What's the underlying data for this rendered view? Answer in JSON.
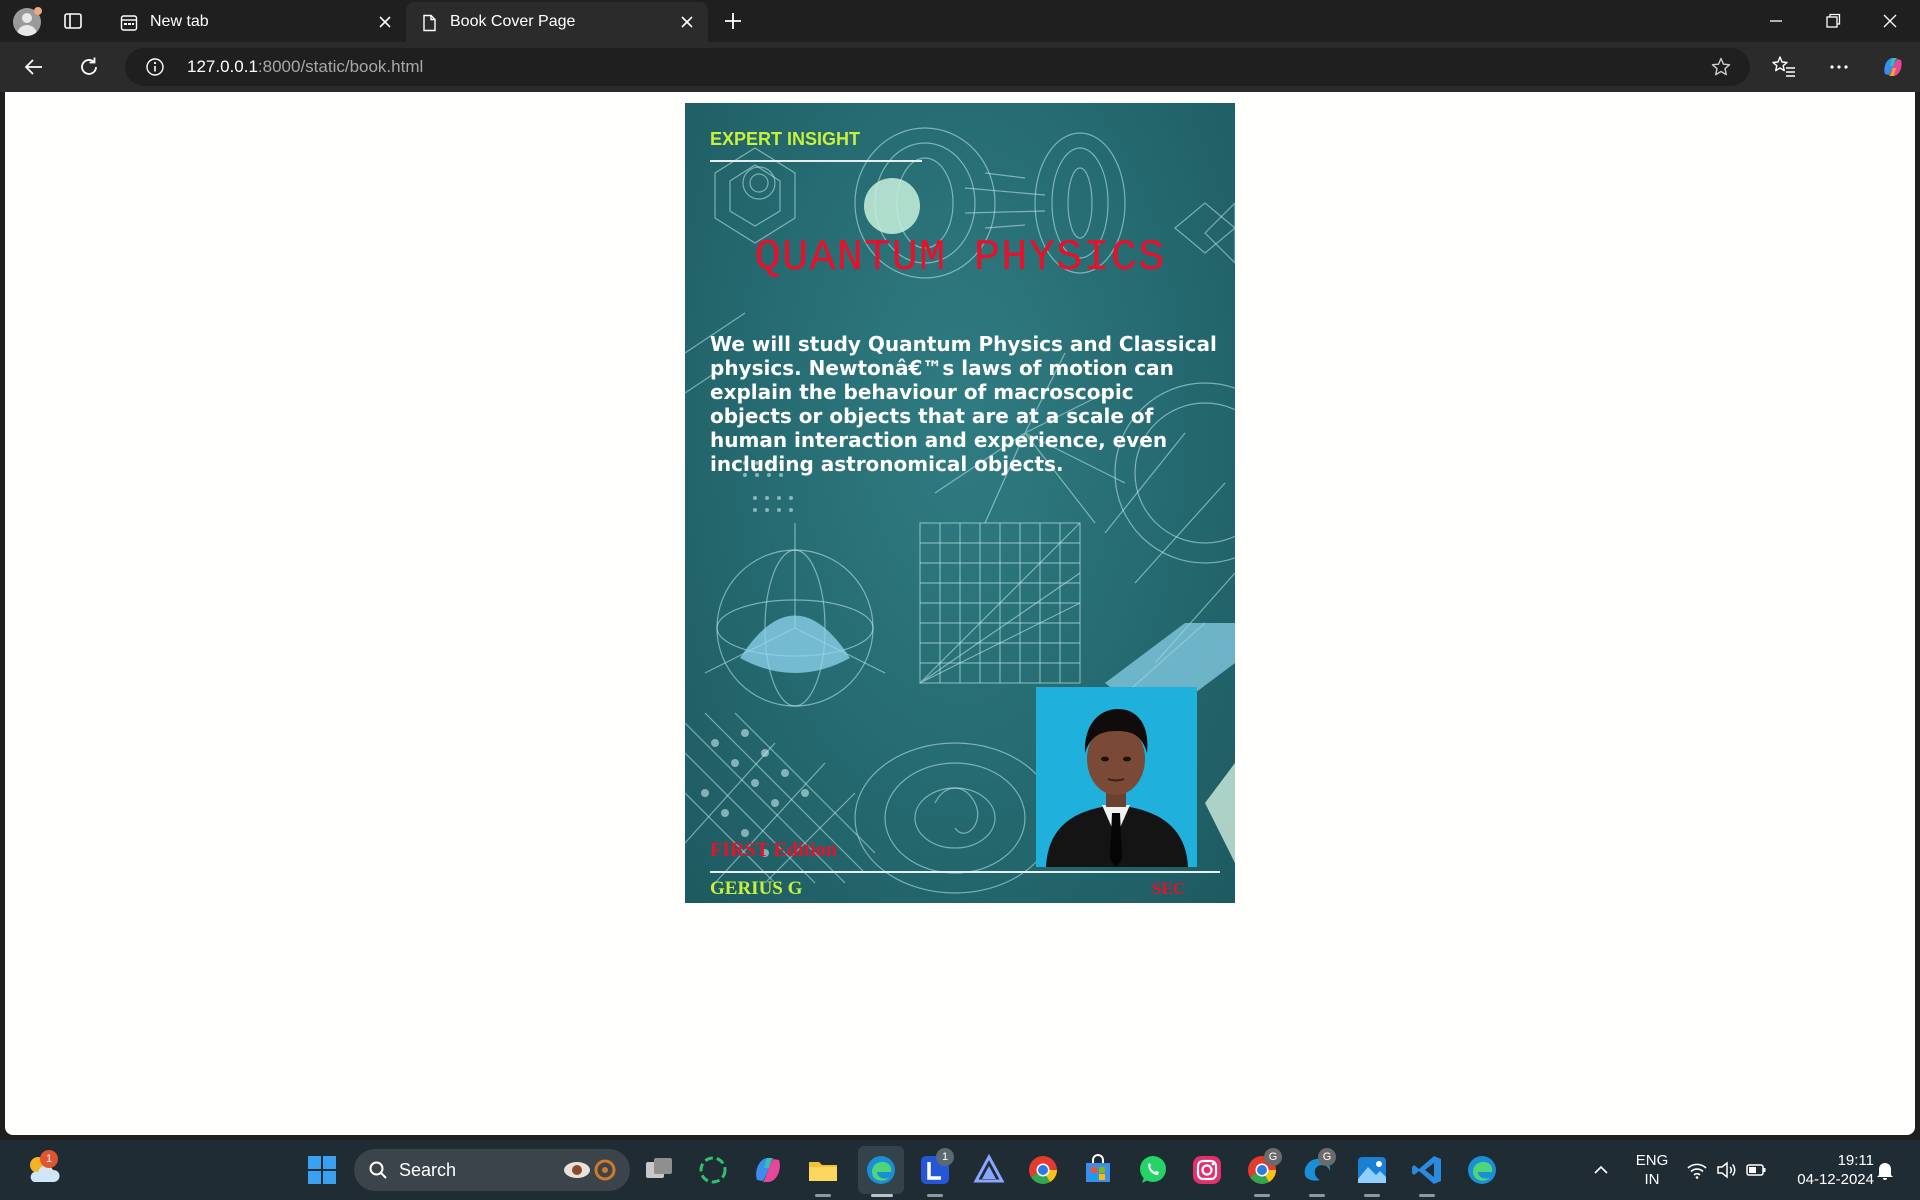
{
  "browser": {
    "tabs": [
      {
        "label": "New tab",
        "active": false
      },
      {
        "label": "Book Cover Page",
        "active": true
      }
    ],
    "address": {
      "host": "127.0.0.1",
      "rest": ":8000/static/book.html"
    }
  },
  "cover": {
    "series_label": "EXPERT INSIGHT",
    "title": "QUANTUM PHYSICS",
    "description": "We will study Quantum Physics and Classical physics. Newtonâ€™s laws of motion can explain the behaviour of macroscopic objects or objects that are at a scale of human interaction and experience, even including astronomical objects.",
    "edition": "FIRST Edition",
    "author": "GERIUS G",
    "publisher": "SEC",
    "colors": {
      "accent_green": "#c7f13a",
      "accent_red": "#e8102a",
      "background": "#256a70"
    }
  },
  "taskbar": {
    "search_label": "Search",
    "weather_badge": "1",
    "lens_badge": "1",
    "chrome_badge": "G",
    "edge_badge": "G",
    "language_top": "ENG",
    "language_bottom": "IN",
    "time": "19:11",
    "date": "04-12-2024",
    "icons": [
      "weather-icon",
      "windows-start-icon",
      "search-icon",
      "task-view-icon",
      "copilot-icon",
      "file-explorer-icon",
      "edge-icon",
      "lens-icon",
      "affine-icon",
      "chrome-icon",
      "store-icon",
      "whatsapp-icon",
      "instagram-icon",
      "chrome-profile-icon",
      "edge-profile-icon",
      "photos-icon",
      "vscode-icon",
      "edge-dev-icon"
    ]
  }
}
